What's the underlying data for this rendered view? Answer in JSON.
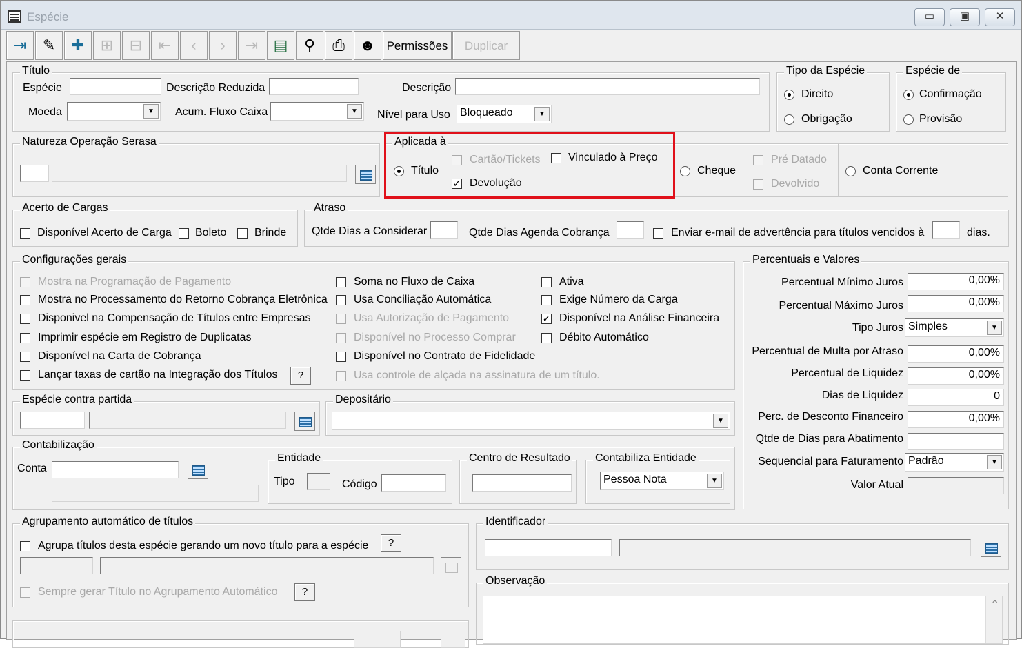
{
  "window": {
    "title": "Espécie",
    "min": "▭",
    "max": "▣",
    "close": "✕"
  },
  "toolbar": {
    "buttons": [
      {
        "icon": "exit-icon",
        "glyph": "⇥"
      },
      {
        "icon": "eraser-icon",
        "glyph": "✎"
      },
      {
        "icon": "add-icon",
        "glyph": "✚"
      },
      {
        "icon": "edit-icon",
        "glyph": "⊞"
      },
      {
        "icon": "remove-icon",
        "glyph": "⊟"
      },
      {
        "icon": "first-icon",
        "glyph": "⇤"
      },
      {
        "icon": "prev-icon",
        "glyph": "‹"
      },
      {
        "icon": "next-icon",
        "glyph": "›"
      },
      {
        "icon": "last-icon",
        "glyph": "⇥"
      },
      {
        "icon": "list-icon",
        "glyph": "▤"
      },
      {
        "icon": "search-icon",
        "glyph": "⚲"
      },
      {
        "icon": "print-icon",
        "glyph": "⎙"
      },
      {
        "icon": "help-icon",
        "glyph": "☻"
      }
    ],
    "permissoes": "Permissões",
    "duplicar": "Duplicar"
  },
  "titulo": {
    "legend": "Título",
    "especie_label": "Espécie",
    "desc_reduzida_label": "Descrição Reduzida",
    "descricao_label": "Descrição",
    "moeda_label": "Moeda",
    "acum_label": "Acum. Fluxo Caixa",
    "nivel_label": "Nível para Uso",
    "nivel_value": "Bloqueado"
  },
  "tipo_especie": {
    "legend": "Tipo da Espécie",
    "opt1": "Direito",
    "opt2": "Obrigação"
  },
  "especie_de": {
    "legend": "Espécie de",
    "opt1": "Confirmação",
    "opt2": "Provisão"
  },
  "natureza": {
    "legend": "Natureza Operação Serasa"
  },
  "aplicada": {
    "legend": "Aplicada à",
    "titulo": "Título",
    "cartao": "Cartão/Tickets",
    "vinculado": "Vinculado à Preço",
    "devolucao": "Devolução",
    "cheque": "Cheque",
    "pre_datado": "Pré Datado",
    "devolvido": "Devolvido",
    "conta_corrente": "Conta Corrente"
  },
  "acerto": {
    "legend": "Acerto de Cargas",
    "disp": "Disponível Acerto de Carga",
    "boleto": "Boleto",
    "brinde": "Brinde"
  },
  "atraso": {
    "legend": "Atraso",
    "qtde_considerar": "Qtde Dias a Considerar",
    "qtde_agenda": "Qtde Dias Agenda Cobrança",
    "email": "Enviar e-mail de advertência para títulos vencidos à",
    "dias": "dias."
  },
  "config": {
    "legend": "Configurações gerais",
    "col1": [
      {
        "text": "Mostra na Programação de Pagamento",
        "checked": false,
        "disabled": true
      },
      {
        "text": "Mostra no Processamento do Retorno Cobrança Eletrônica",
        "checked": false,
        "disabled": false
      },
      {
        "text": "Disponivel na Compensação de Títulos entre Empresas",
        "checked": false,
        "disabled": false
      },
      {
        "text": "Imprimir espécie em Registro de Duplicatas",
        "checked": false,
        "disabled": false
      },
      {
        "text": "Disponível na Carta de Cobrança",
        "checked": false,
        "disabled": false
      },
      {
        "text": "Lançar taxas de cartão na Integração dos Títulos",
        "checked": false,
        "disabled": false
      }
    ],
    "col2": [
      {
        "text": "Soma no Fluxo de Caixa",
        "checked": false,
        "disabled": false
      },
      {
        "text": "Usa Conciliação Automática",
        "checked": false,
        "disabled": false
      },
      {
        "text": "Usa Autorização de Pagamento",
        "checked": false,
        "disabled": true
      },
      {
        "text": "Disponível no Processo Comprar",
        "checked": false,
        "disabled": true
      },
      {
        "text": "Disponível no Contrato de Fidelidade",
        "checked": false,
        "disabled": false
      },
      {
        "text": "Usa controle de alçada na assinatura de um título.",
        "checked": false,
        "disabled": true
      }
    ],
    "col3": [
      {
        "text": "Ativa",
        "checked": false,
        "disabled": false
      },
      {
        "text": "Exige Número da Carga",
        "checked": false,
        "disabled": false
      },
      {
        "text": "Disponível na Análise Financeira",
        "checked": true,
        "disabled": false
      },
      {
        "text": "Débito Automático",
        "checked": false,
        "disabled": false
      }
    ],
    "help": "?"
  },
  "percentuais": {
    "legend": "Percentuais e Valores",
    "rows": [
      {
        "label": "Percentual Mínimo Juros",
        "value": "0,00%"
      },
      {
        "label": "Percentual Máximo Juros",
        "value": "0,00%"
      },
      {
        "label": "Tipo Juros",
        "value": "Simples"
      },
      {
        "label": "Percentual de Multa por Atraso",
        "value": "0,00%"
      },
      {
        "label": "Percentual de Liquidez",
        "value": "0,00%"
      },
      {
        "label": "Dias de Liquidez",
        "value": "0"
      },
      {
        "label": "Perc. de Desconto Financeiro",
        "value": "0,00%"
      },
      {
        "label": "Qtde de Dias para Abatimento",
        "value": ""
      },
      {
        "label": "Sequencial para Faturamento",
        "value": "Padrão"
      },
      {
        "label": "Valor Atual",
        "value": ""
      }
    ]
  },
  "contrapartida": {
    "legend": "Espécie contra partida"
  },
  "depositario": {
    "legend": "Depositário"
  },
  "contab": {
    "legend": "Contabilização",
    "conta": "Conta",
    "entidade": "Entidade",
    "tipo": "Tipo",
    "codigo": "Código",
    "centro": "Centro de Resultado",
    "contabiliza": "Contabiliza Entidade",
    "contabiliza_value": "Pessoa Nota"
  },
  "agrup": {
    "legend": "Agrupamento automático de títulos",
    "agrupa": "Agrupa títulos desta espécie gerando um novo título para a espécie",
    "sempre": "Sempre gerar Título no  Agrupamento Automático",
    "help": "?"
  },
  "identificador": {
    "legend": "Identificador"
  },
  "observacao": {
    "legend": "Observação",
    "scroll_up": "⌃"
  }
}
